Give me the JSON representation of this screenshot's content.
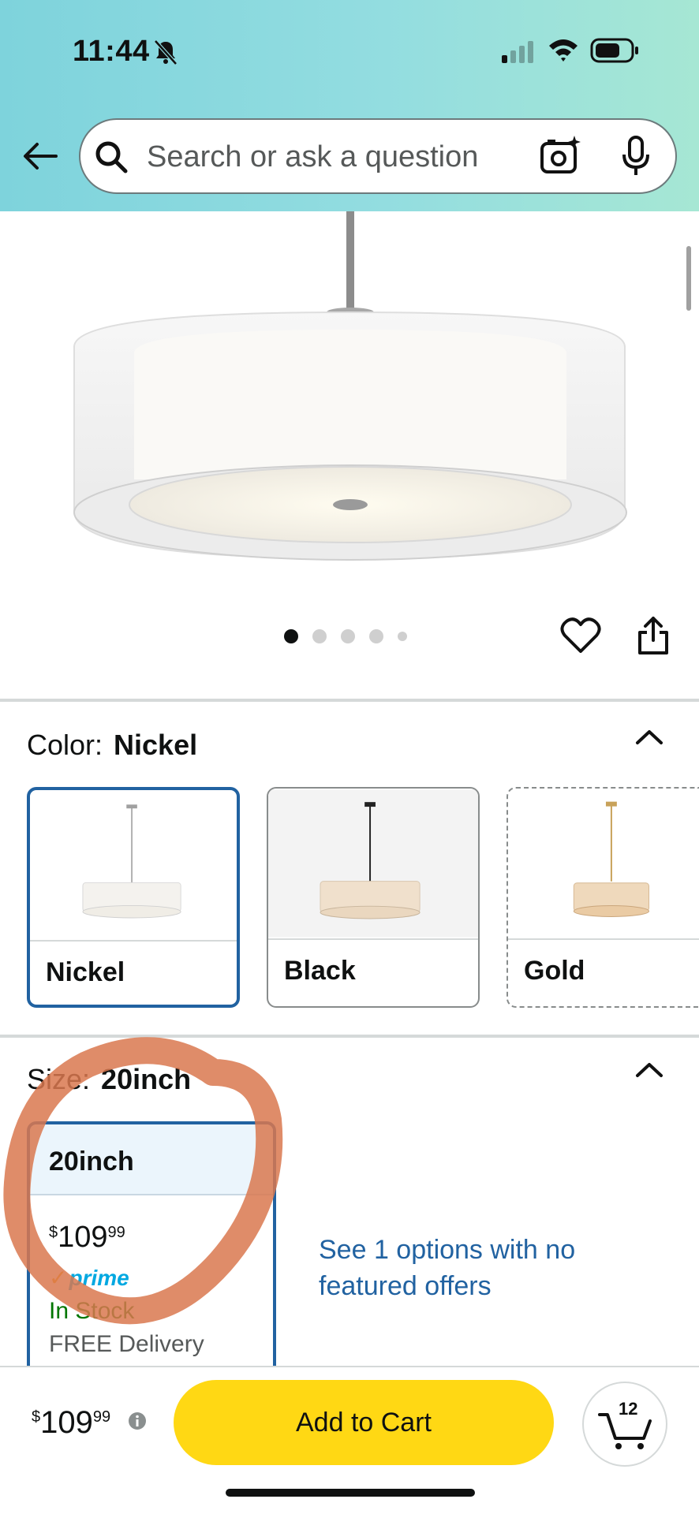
{
  "status_bar": {
    "time": "11:44"
  },
  "search": {
    "placeholder": "Search or ask a question"
  },
  "gallery": {
    "dot_count": 5,
    "active_index": 0
  },
  "color": {
    "label": "Color:",
    "selected": "Nickel",
    "options": [
      {
        "label": "Nickel",
        "selected": true
      },
      {
        "label": "Black",
        "selected": false
      },
      {
        "label": "Gold",
        "selected": false
      }
    ]
  },
  "size": {
    "label": "Size:",
    "selected": "20inch",
    "card": {
      "title": "20inch",
      "price_symbol": "$",
      "price_whole": "109",
      "price_fraction": "99",
      "prime": "prime",
      "stock": "In Stock",
      "delivery": "FREE Delivery"
    },
    "see_options": "See 1 options with no featured offers"
  },
  "bottom_bar": {
    "price_symbol": "$",
    "price_whole": "109",
    "price_fraction": "99",
    "add_to_cart": "Add to Cart",
    "cart_count": "12"
  },
  "colors": {
    "accent_blue": "#2162a1",
    "cta_yellow": "#ffd814",
    "annotation": "#d9784f"
  }
}
